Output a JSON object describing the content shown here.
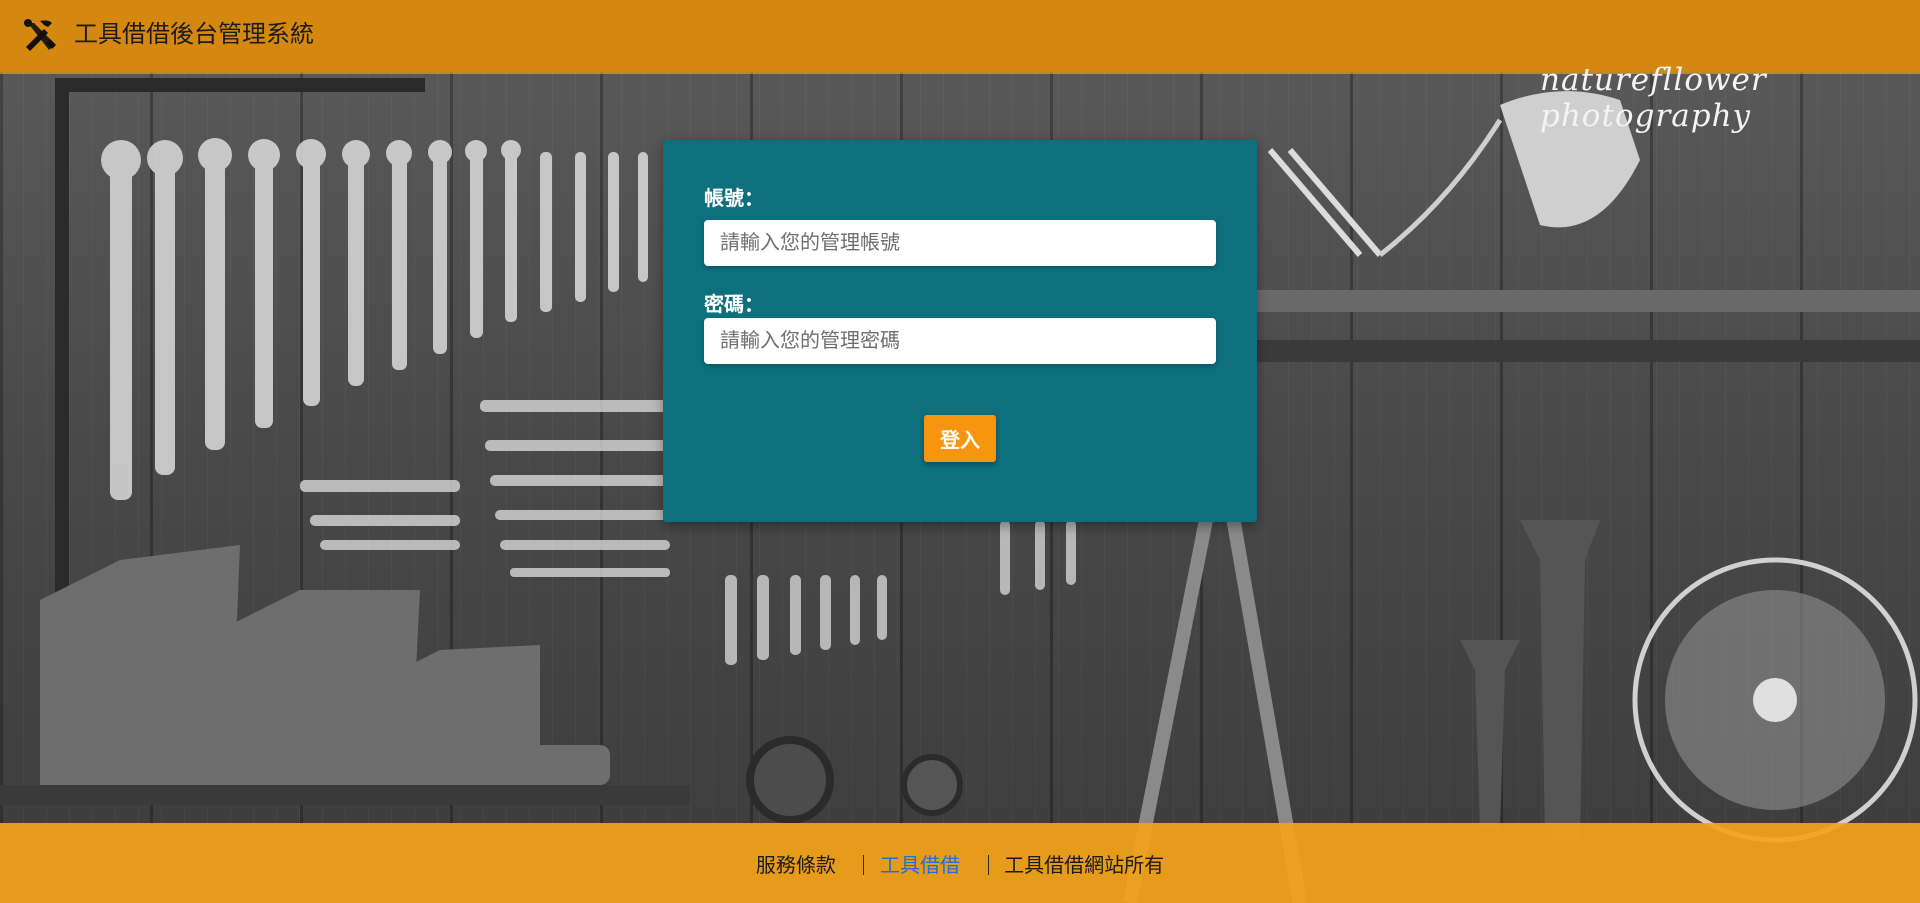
{
  "header": {
    "title": "工具借借後台管理系統",
    "logo_icon": "tools-icon"
  },
  "watermark": "naturefllower photography",
  "login": {
    "account_label": "帳號：",
    "account_placeholder": "請輸入您的管理帳號",
    "password_label": "密碼：",
    "password_placeholder": "請輸入您的管理密碼",
    "submit_label": "登入"
  },
  "footer": {
    "terms": "服務條款",
    "brand_link": "工具借借",
    "copyright": "工具借借網站所有"
  },
  "colors": {
    "header": "#da8a0c",
    "card": "#0e6f7d",
    "button": "#f7960e",
    "footer": "#f3a318",
    "link_active": "#1f6fd6"
  }
}
